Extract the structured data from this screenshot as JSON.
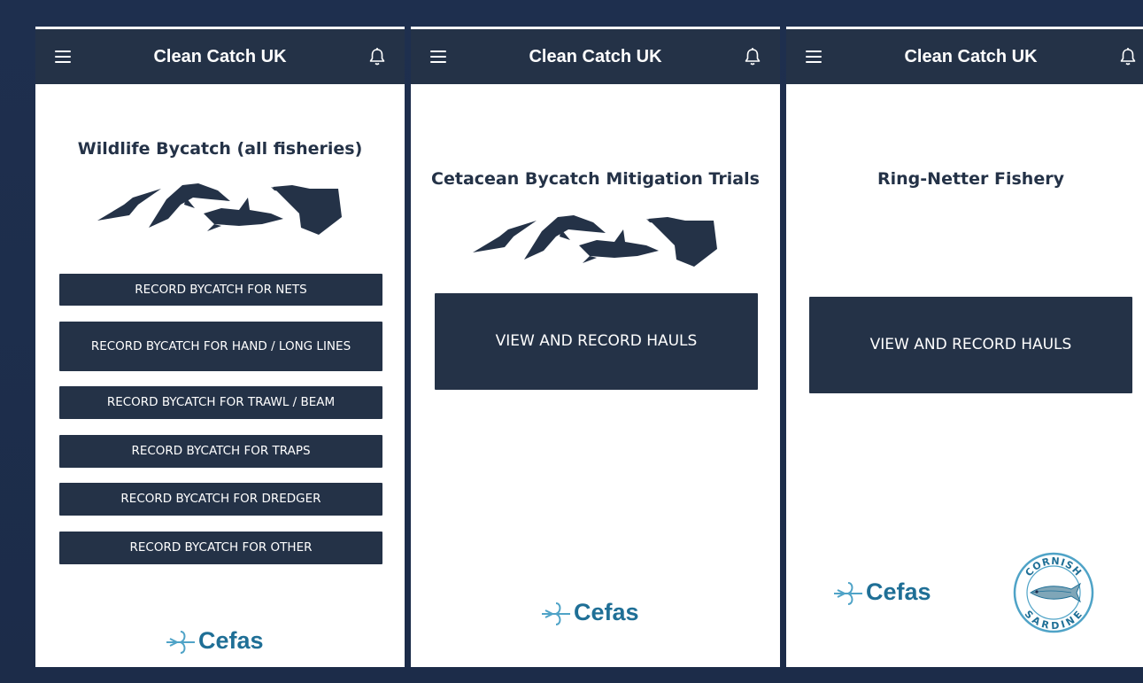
{
  "colors": {
    "appbar": "#243247",
    "button": "#243247",
    "logo": "#1f6f96",
    "background": "#1f3050"
  },
  "appbar": {
    "title": "Clean Catch UK",
    "menu_icon": "menu-icon",
    "bell_icon": "bell-icon"
  },
  "screens": [
    {
      "heading": "Wildlife Bycatch (all fisheries)",
      "buttons": [
        "RECORD BYCATCH FOR NETS",
        "RECORD BYCATCH FOR HAND / LONG LINES",
        "RECORD BYCATCH FOR TRAWL / BEAM",
        "RECORD BYCATCH FOR TRAPS",
        "RECORD BYCATCH FOR DREDGER",
        "RECORD BYCATCH FOR OTHER"
      ],
      "logo": "Cefas"
    },
    {
      "heading": "Cetacean Bycatch Mitigation Trials",
      "buttons": [
        "VIEW AND RECORD HAULS"
      ],
      "logo": "Cefas"
    },
    {
      "heading": "Ring-Netter Fishery",
      "buttons": [
        "VIEW AND RECORD HAULS"
      ],
      "logo": "Cefas",
      "badge": {
        "top": "CORNISH",
        "bottom": "SARDINE"
      }
    }
  ]
}
